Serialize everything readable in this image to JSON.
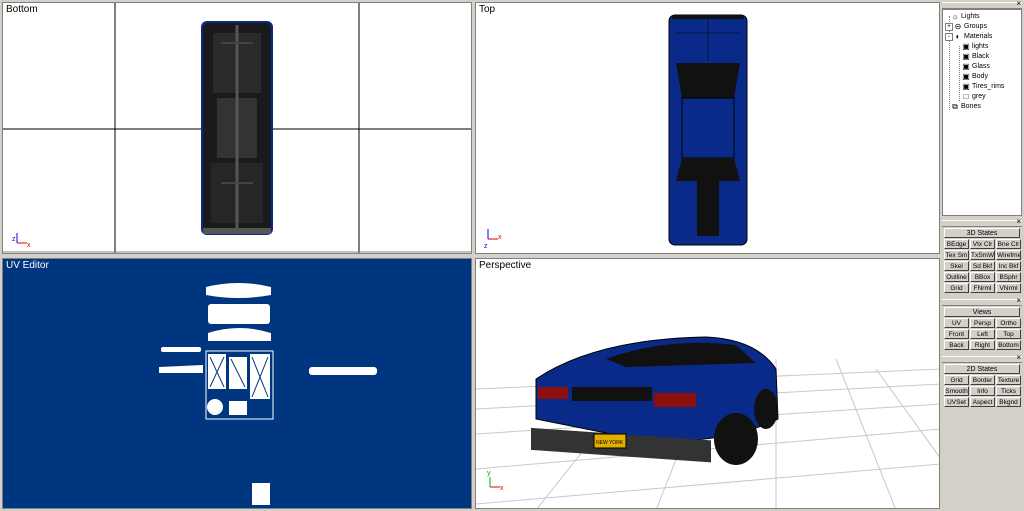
{
  "viewports": {
    "bottom": {
      "title": "Bottom"
    },
    "top": {
      "title": "Top"
    },
    "uv": {
      "title": "UV Editor"
    },
    "perspective": {
      "title": "Perspective"
    }
  },
  "axes": {
    "x": "x",
    "z": "z",
    "y": "y"
  },
  "plate_text": "NEW YORK",
  "tree": {
    "close": "×",
    "items": [
      {
        "label": "Lights",
        "icon": "light-bulb-icon"
      },
      {
        "label": "Groups",
        "icon": "groups-icon",
        "expander": "+"
      },
      {
        "label": "Materials",
        "icon": "material-sphere-icon",
        "expander": "-"
      },
      {
        "label": "lights",
        "icon": "material-icon"
      },
      {
        "label": "Black",
        "icon": "material-icon"
      },
      {
        "label": "Glass",
        "icon": "material-icon"
      },
      {
        "label": "Body",
        "icon": "material-icon"
      },
      {
        "label": "Tires_rims",
        "icon": "material-icon"
      },
      {
        "label": "grey",
        "icon": "material-icon"
      },
      {
        "label": "Bones",
        "icon": "bones-icon"
      }
    ]
  },
  "states3d": {
    "title": "3D States",
    "buttons": [
      "BEdge",
      "Vtx Clr",
      "Bne Clr",
      "Tex Sm",
      "TxSmWr",
      "Wirefme",
      "Skel",
      "Sd Bkf",
      "Inc Bkf",
      "Outline",
      "BBox",
      "BSphr",
      "Grid",
      "FNrml",
      "VNrml"
    ]
  },
  "views": {
    "title": "Views",
    "buttons": [
      "UV",
      "Persp",
      "Ortho",
      "Front",
      "Left",
      "Top",
      "Back",
      "Right",
      "Bottom"
    ]
  },
  "states2d": {
    "title": "2D States",
    "buttons": [
      "Grid",
      "Border",
      "Texture",
      "Smooth",
      "Info",
      "Ticks",
      "UVSet",
      "Aspect",
      "Bkgnd"
    ]
  },
  "colors": {
    "uv_bg": "#003580",
    "car_blue": "#0a2a8a",
    "panel": "#d4d0c8"
  }
}
